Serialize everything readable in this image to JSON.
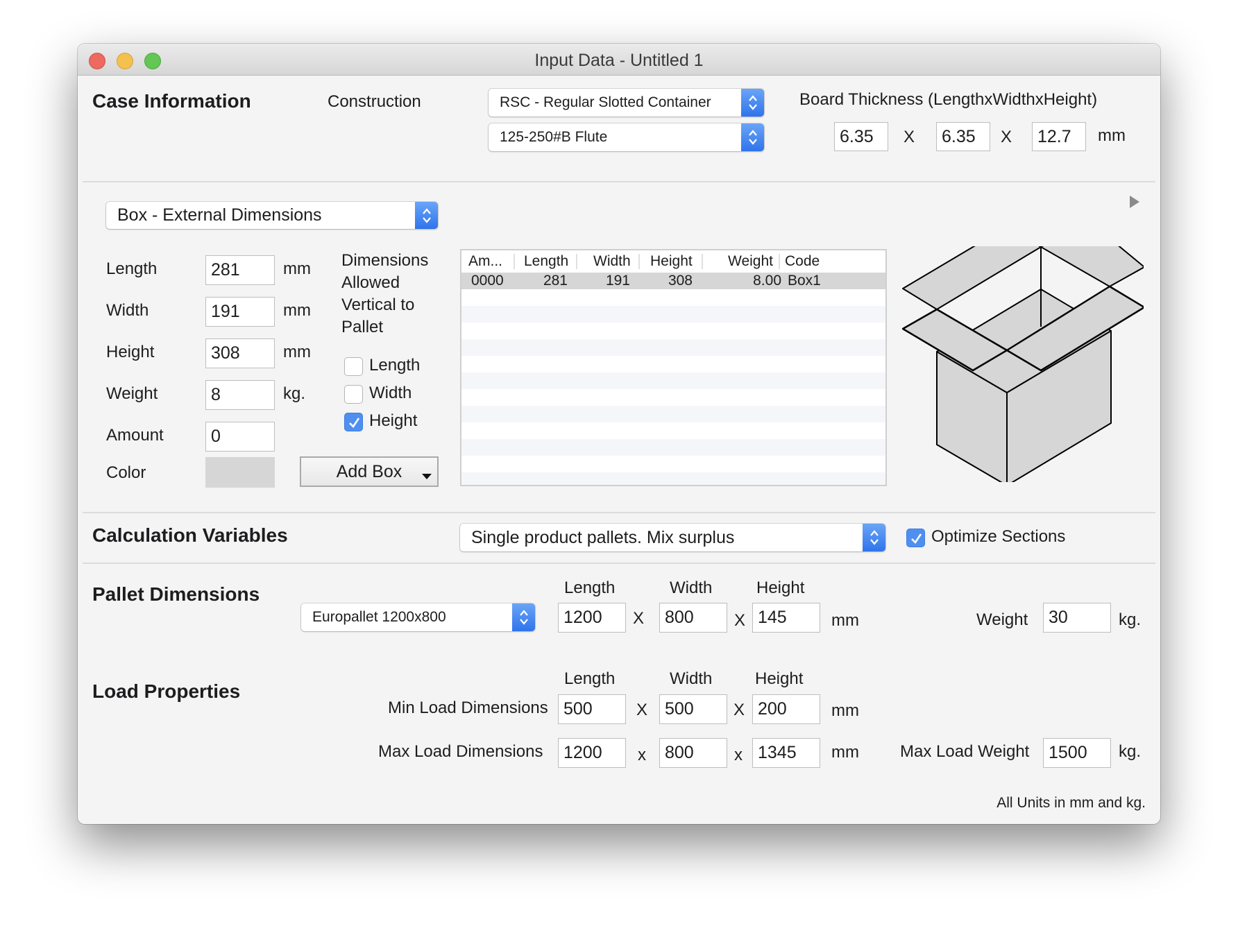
{
  "window": {
    "title": "Input Data - Untitled 1"
  },
  "case_information": {
    "heading": "Case Information",
    "construction_label": "Construction",
    "construction_value": "RSC - Regular Slotted Container",
    "flute_value": "125-250#B Flute",
    "board_thickness_label": "Board Thickness (LengthxWidthxHeight)",
    "thickness_length": "6.35",
    "thickness_width": "6.35",
    "thickness_height": "12.7",
    "separator": "X",
    "unit": "mm"
  },
  "box": {
    "mode_value": "Box - External Dimensions",
    "fields": [
      {
        "label": "Length",
        "value": "281",
        "unit": "mm"
      },
      {
        "label": "Width",
        "value": "191",
        "unit": "mm"
      },
      {
        "label": "Height",
        "value": "308",
        "unit": "mm"
      },
      {
        "label": "Weight",
        "value": "8",
        "unit": "kg."
      },
      {
        "label": "Amount",
        "value": "0",
        "unit": ""
      }
    ],
    "color_label": "Color",
    "color_value": "#d6d6d6",
    "vertical_heading_lines": [
      "Dimensions",
      "Allowed",
      "Vertical to",
      "Pallet"
    ],
    "vertical_options": [
      {
        "label": "Length",
        "checked": false
      },
      {
        "label": "Width",
        "checked": false
      },
      {
        "label": "Height",
        "checked": true
      }
    ],
    "add_button": "Add Box",
    "table": {
      "columns": [
        "Am...",
        "Length",
        "Width",
        "Height",
        "Weight",
        "Code"
      ],
      "rows": [
        {
          "amount": "0000",
          "length": "281",
          "width": "191",
          "height": "308",
          "weight": "8.00",
          "code": "Box1"
        }
      ]
    }
  },
  "calculation": {
    "heading": "Calculation Variables",
    "mode_value": "Single product pallets. Mix surplus",
    "optimize_label": "Optimize Sections",
    "optimize_checked": true
  },
  "pallet": {
    "heading": "Pallet Dimensions",
    "type_value": "Europallet 1200x800",
    "col_length": "Length",
    "col_width": "Width",
    "col_height": "Height",
    "length": "1200",
    "width": "800",
    "height": "145",
    "separator": "X",
    "unit": "mm",
    "weight_label": "Weight",
    "weight": "30",
    "weight_unit": "kg."
  },
  "load": {
    "heading": "Load Properties",
    "col_length": "Length",
    "col_width": "Width",
    "col_height": "Height",
    "min_label": "Min Load Dimensions",
    "min_length": "500",
    "min_width": "500",
    "min_height": "200",
    "max_label": "Max Load Dimensions",
    "max_length": "1200",
    "max_width": "800",
    "max_height": "1345",
    "separator": "X",
    "separator_lower": "x",
    "unit": "mm",
    "max_weight_label": "Max Load Weight",
    "max_weight": "1500",
    "weight_unit": "kg."
  },
  "footer": {
    "note": "All Units in mm and kg."
  }
}
